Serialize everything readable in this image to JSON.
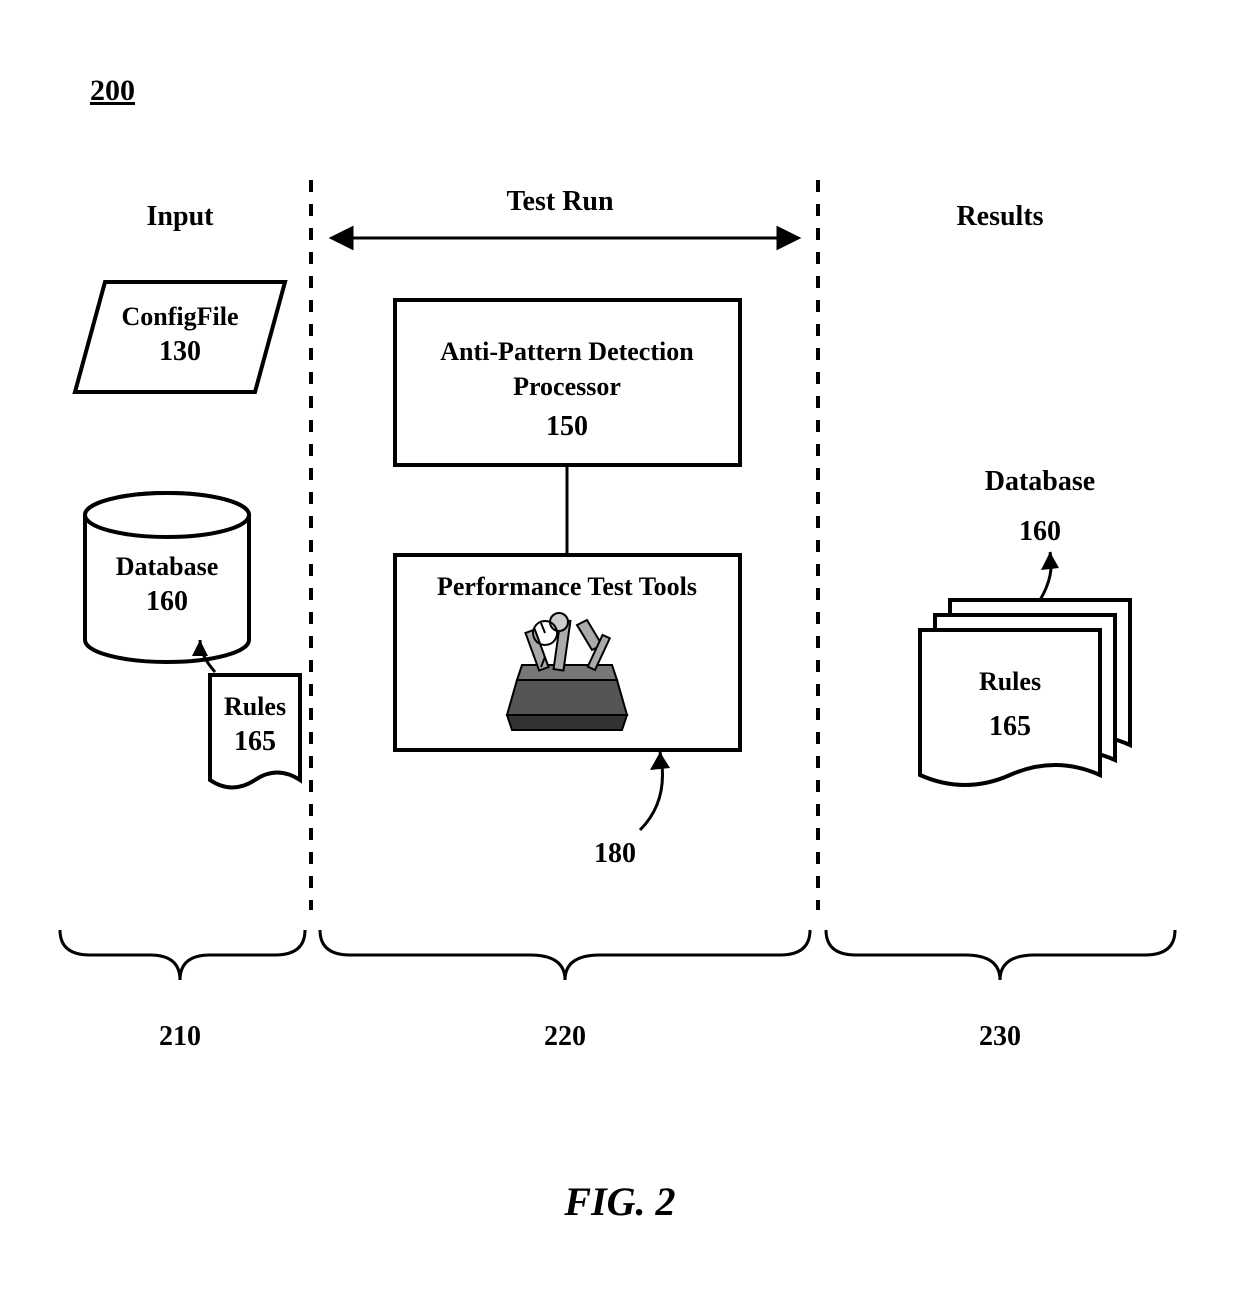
{
  "page_ref": "200",
  "sections": {
    "input": {
      "title": "Input",
      "brace_ref": "210"
    },
    "testrun": {
      "title": "Test Run",
      "brace_ref": "220"
    },
    "results": {
      "title": "Results",
      "brace_ref": "230"
    }
  },
  "config_file": {
    "label": "ConfigFile",
    "ref": "130"
  },
  "database_left": {
    "label": "Database",
    "ref": "160"
  },
  "rules_left": {
    "label": "Rules",
    "ref": "165"
  },
  "anti_pattern": {
    "label_line1": "Anti-Pattern Detection",
    "label_line2": "Processor",
    "ref": "150"
  },
  "perf_tools": {
    "label": "Performance Test Tools",
    "ref": "180"
  },
  "database_right": {
    "label": "Database",
    "ref": "160"
  },
  "rules_right": {
    "label": "Rules",
    "ref": "165"
  },
  "figure_caption": "FIG. 2"
}
